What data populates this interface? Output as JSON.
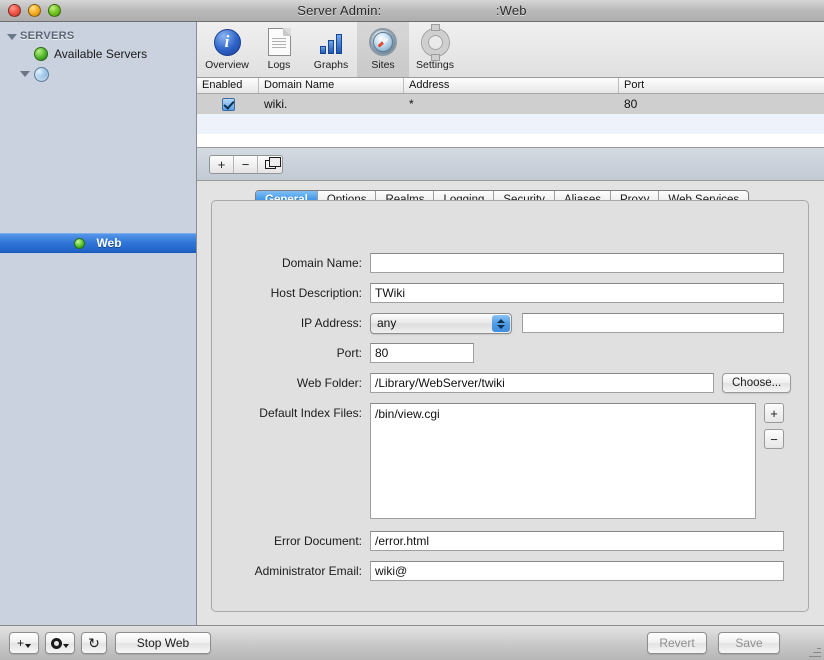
{
  "window": {
    "title": "Server Admin:                              :Web",
    "traffic_lights": [
      "close",
      "minimize",
      "zoom"
    ]
  },
  "sidebar": {
    "group_label": "SERVERS",
    "items": [
      {
        "label": "Available Servers",
        "icon": "green-globe-icon",
        "selected": false
      },
      {
        "label": "",
        "icon": "blue-globe-icon",
        "selected": false
      },
      {
        "label": "Web",
        "icon": "green-status-dot-icon",
        "selected": true
      }
    ]
  },
  "toolbar": {
    "items": [
      {
        "label": "Overview",
        "icon": "info-icon",
        "active": false
      },
      {
        "label": "Logs",
        "icon": "document-icon",
        "active": false
      },
      {
        "label": "Graphs",
        "icon": "bar-chart-icon",
        "active": false
      },
      {
        "label": "Sites",
        "icon": "compass-icon",
        "active": true
      },
      {
        "label": "Settings",
        "icon": "gear-icon",
        "active": false
      }
    ]
  },
  "sites_table": {
    "columns": [
      "Enabled",
      "Domain Name",
      "Address",
      "Port"
    ],
    "rows": [
      {
        "enabled": true,
        "domain_name": "wiki.",
        "address": "*",
        "port": "80"
      }
    ],
    "controls": {
      "add": "+",
      "remove": "−",
      "duplicate": "duplicate-icon"
    }
  },
  "tabs": [
    {
      "label": "General",
      "active": true
    },
    {
      "label": "Options",
      "active": false
    },
    {
      "label": "Realms",
      "active": false
    },
    {
      "label": "Logging",
      "active": false
    },
    {
      "label": "Security",
      "active": false
    },
    {
      "label": "Aliases",
      "active": false
    },
    {
      "label": "Proxy",
      "active": false
    },
    {
      "label": "Web Services",
      "active": false
    }
  ],
  "form": {
    "domain_name": {
      "label": "Domain Name:",
      "value": ""
    },
    "host_description": {
      "label": "Host Description:",
      "value": "TWiki"
    },
    "ip_address": {
      "label": "IP Address:",
      "selected": "any",
      "extra_value": ""
    },
    "port": {
      "label": "Port:",
      "value": "80"
    },
    "web_folder": {
      "label": "Web Folder:",
      "value": "/Library/WebServer/twiki",
      "choose_label": "Choose..."
    },
    "default_index_files": {
      "label": "Default Index Files:",
      "value": "/bin/view.cgi",
      "add": "+",
      "remove": "−"
    },
    "error_document": {
      "label": "Error Document:",
      "value": "/error.html"
    },
    "administrator_email": {
      "label": "Administrator Email:",
      "value": "wiki@"
    }
  },
  "bottom_bar": {
    "add_label": "+",
    "gear_label": "gear-icon",
    "refresh_label": "↻",
    "service_toggle": "Stop Web",
    "revert": "Revert",
    "save": "Save"
  },
  "colors": {
    "accent_blue": "#2f74d6",
    "tab_active": "#3c94e8",
    "sidebar_bg": "#c9d2de",
    "panel_bg": "#e0e0e0",
    "status_green": "#55c62a"
  }
}
